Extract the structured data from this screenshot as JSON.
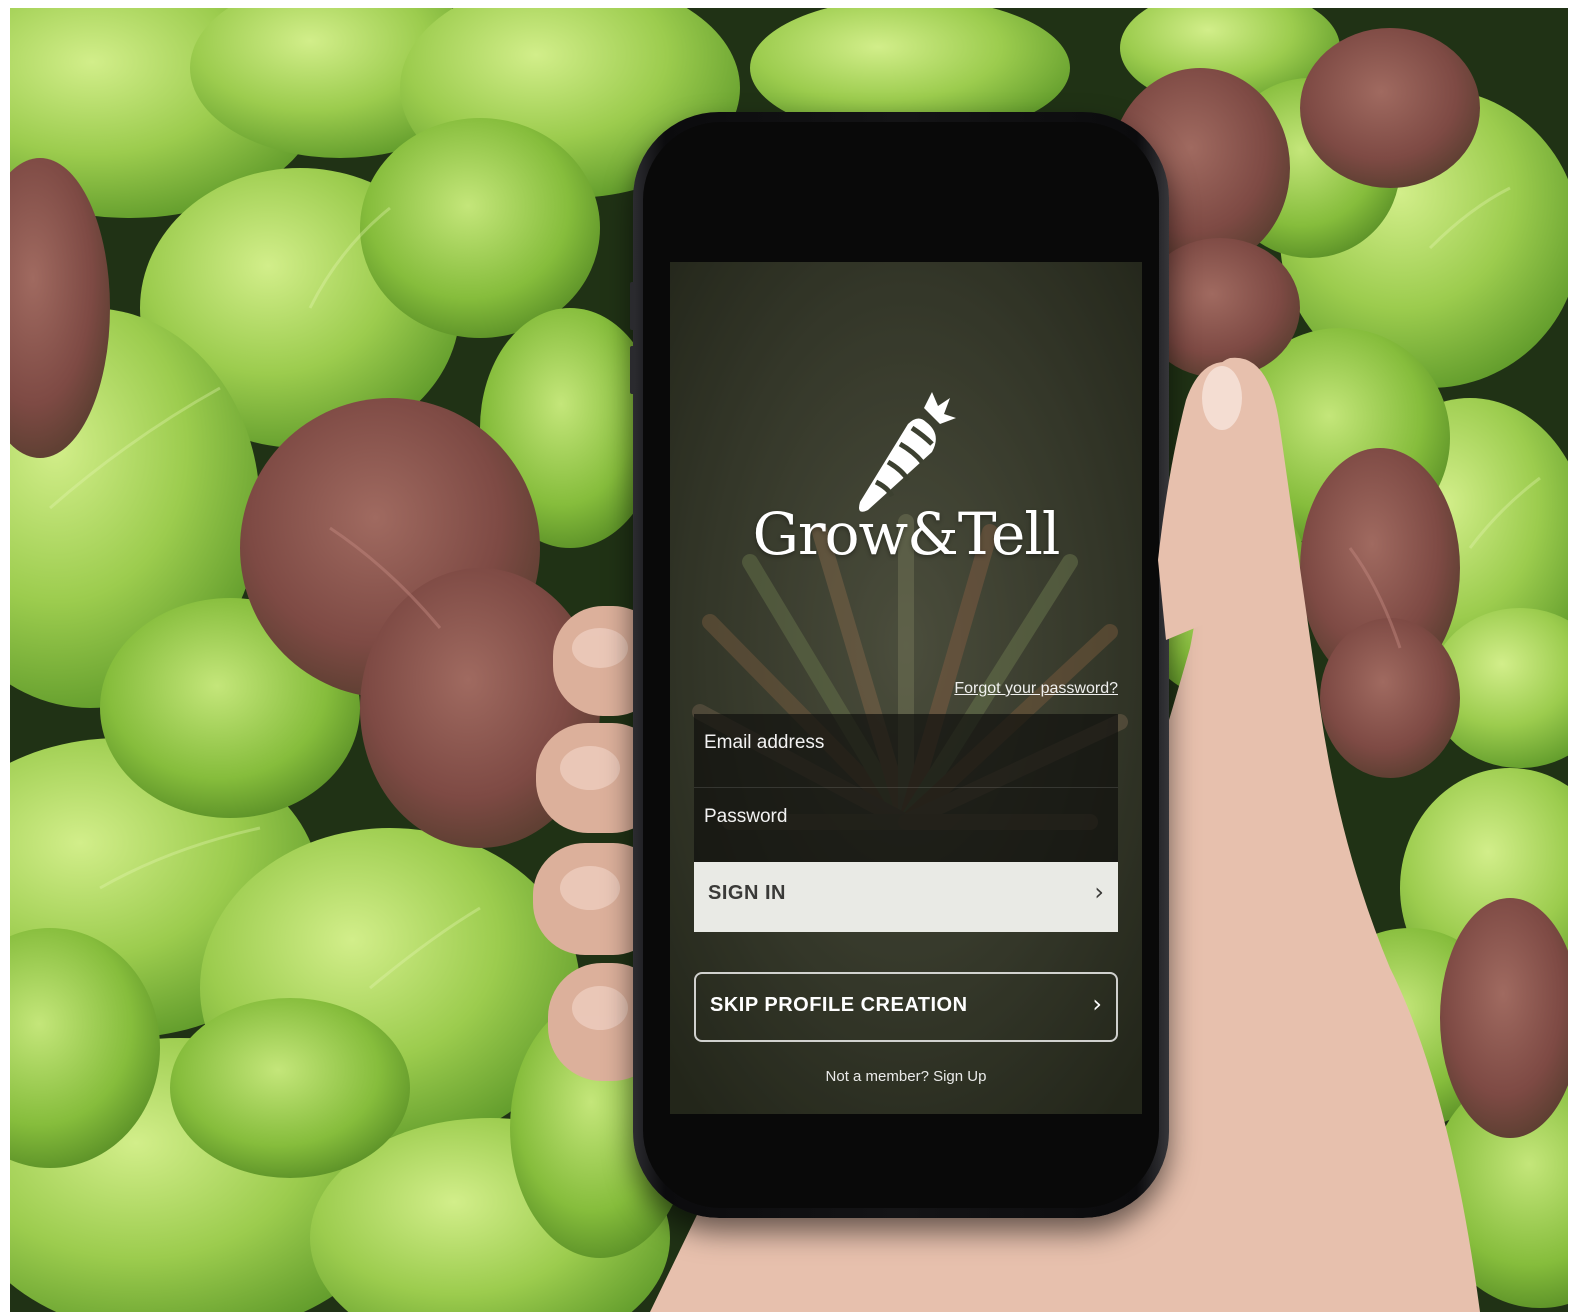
{
  "app": {
    "title": "Grow&Tell",
    "logo_icon": "carrot-icon"
  },
  "login": {
    "forgot_password": "Forgot your password?",
    "email_placeholder": "Email address",
    "password_placeholder": "Password",
    "sign_in_label": "SIGN IN",
    "chevron": "›"
  },
  "skip": {
    "label": "SKIP PROFILE CREATION",
    "chevron": "›"
  },
  "signup": {
    "prompt": "Not a member?",
    "separator": " ",
    "link": "Sign Up"
  },
  "colors": {
    "leaf_light": "#a6d15a",
    "leaf_mid": "#7fb83a",
    "leaf_red": "#8a4a44",
    "button_light": "#e9eae5"
  }
}
